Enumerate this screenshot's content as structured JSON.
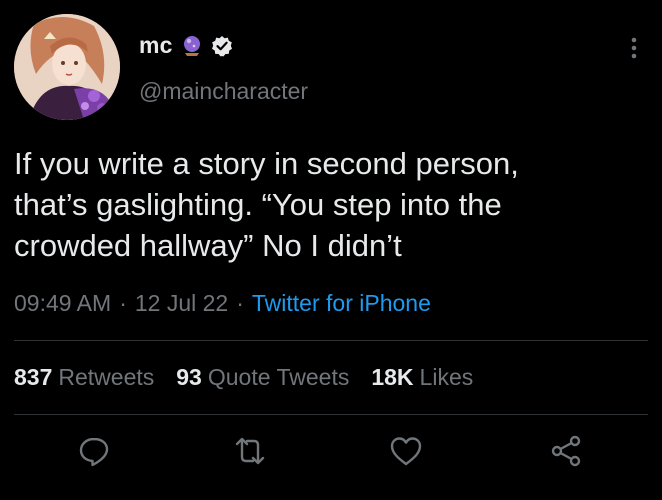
{
  "author": {
    "display_name": "mc",
    "handle": "@maincharacter",
    "name_emoji_icon": "crystal-ball-icon",
    "verified_icon": "verified-badge-icon",
    "avatar": "anime-character-avatar"
  },
  "tweet": {
    "text": "If you write a story in second person,\nthat’s gaslighting. “You step into the\ncrowded hallway” No I didn’t",
    "time": "09:49 AM",
    "date": "12 Jul 22",
    "separator": "·",
    "source": "Twitter for iPhone"
  },
  "stats": {
    "retweets_count": "837",
    "retweets_label": "Retweets",
    "quotes_count": "93",
    "quotes_label": "Quote Tweets",
    "likes_count": "18K",
    "likes_label": "Likes"
  },
  "actions": [
    "reply-icon",
    "retweet-icon",
    "like-icon",
    "share-icon"
  ],
  "more_icon": "more-vertical-icon",
  "colors": {
    "background": "#000000",
    "text": "#e7e9ea",
    "muted": "#71767b",
    "link": "#1d9bf0",
    "divider": "#2f3336"
  }
}
